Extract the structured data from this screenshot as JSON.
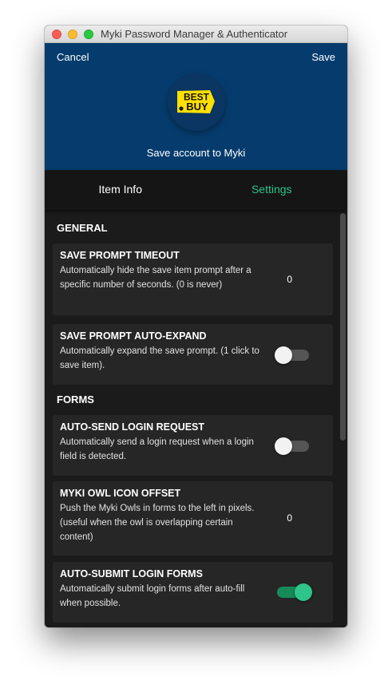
{
  "window": {
    "title": "Myki Password Manager & Authenticator"
  },
  "header": {
    "cancel_label": "Cancel",
    "save_label": "Save",
    "logo_text_line1": "BEST",
    "logo_text_line2": "BUY",
    "subtitle": "Save account to Myki"
  },
  "tabs": [
    {
      "label": "Item Info",
      "active": false
    },
    {
      "label": "Settings",
      "active": true
    }
  ],
  "sections": {
    "general": "GENERAL",
    "forms": "FORMS"
  },
  "settings": {
    "save_prompt_timeout": {
      "title": "SAVE PROMPT TIMEOUT",
      "description": "Automatically hide the save item prompt after a specific number of seconds. (0 is never)",
      "value": "0"
    },
    "save_prompt_auto_expand": {
      "title": "SAVE PROMPT AUTO-EXPAND",
      "description": "Automatically expand the save prompt. (1 click to save item).",
      "enabled": false
    },
    "auto_send_login_request": {
      "title": "AUTO-SEND LOGIN REQUEST",
      "description": "Automatically send a login request when a login field is detected.",
      "enabled": false
    },
    "myki_owl_icon_offset": {
      "title": "MYKI OWL ICON OFFSET",
      "description": "Push the Myki Owls in forms to the left in pixels. (useful when the owl is overlapping certain content)",
      "value": "0"
    },
    "auto_submit_login_forms": {
      "title": "AUTO-SUBMIT LOGIN FORMS",
      "description": "Automatically submit login forms after auto-fill when possible.",
      "enabled": true
    }
  },
  "colors": {
    "header_bg": "#063c6d",
    "accent_green": "#2fc48a",
    "card_bg": "#262626",
    "panel_bg": "#1b1b1b",
    "bestbuy_yellow": "#ffe000"
  }
}
